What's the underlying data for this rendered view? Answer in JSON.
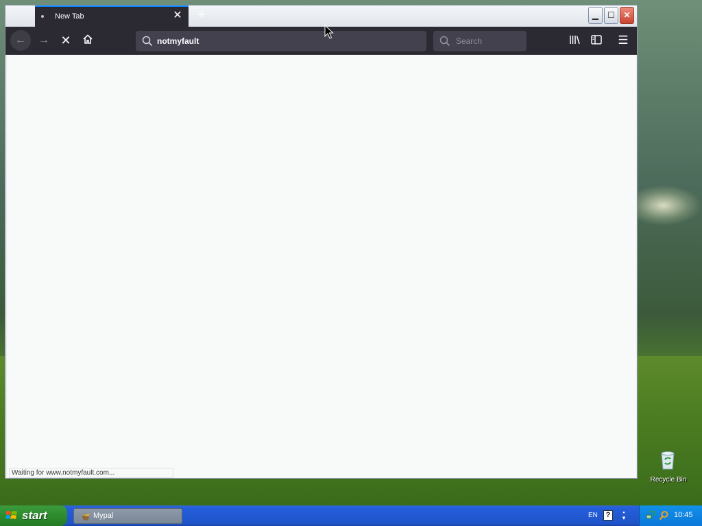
{
  "browser": {
    "tab": {
      "title": "New Tab"
    },
    "url": {
      "value": "notmyfault"
    },
    "search": {
      "placeholder": "Search"
    },
    "status": "Waiting for www.notmyfault.com...",
    "icons": {
      "back": "arrow-left-icon",
      "forward": "arrow-right-icon",
      "stop": "close-icon",
      "home": "home-icon",
      "library": "library-icon",
      "sidebar": "sidebar-icon",
      "menu": "hamburger-menu-icon"
    },
    "colors": {
      "toolbar": "#2b2a33",
      "field": "#42414d",
      "tab_accent": "#0a84ff",
      "content": "#f8f9f9"
    }
  },
  "desktop": {
    "recycle_bin": "Recycle Bin"
  },
  "taskbar": {
    "start": "start",
    "task": "Mypal",
    "language": "EN",
    "help": "?",
    "clock": "10:45"
  }
}
